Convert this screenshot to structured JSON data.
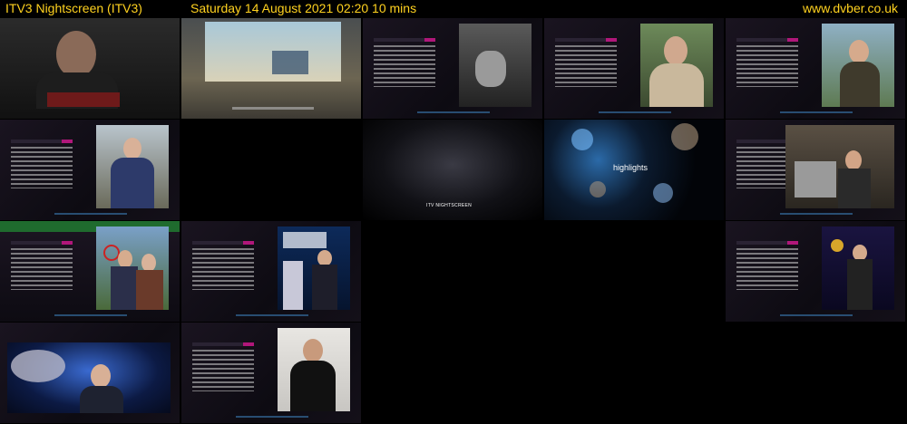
{
  "header": {
    "title": "ITV3 Nightscreen (ITV3)",
    "datetime": "Saturday 14 August 2021  02:20  10 mins",
    "site": "www.dvber.co.uk"
  },
  "colors": {
    "header_text": "#ffd21f",
    "background": "#000000",
    "accent_tag": "#b0177a"
  }
}
